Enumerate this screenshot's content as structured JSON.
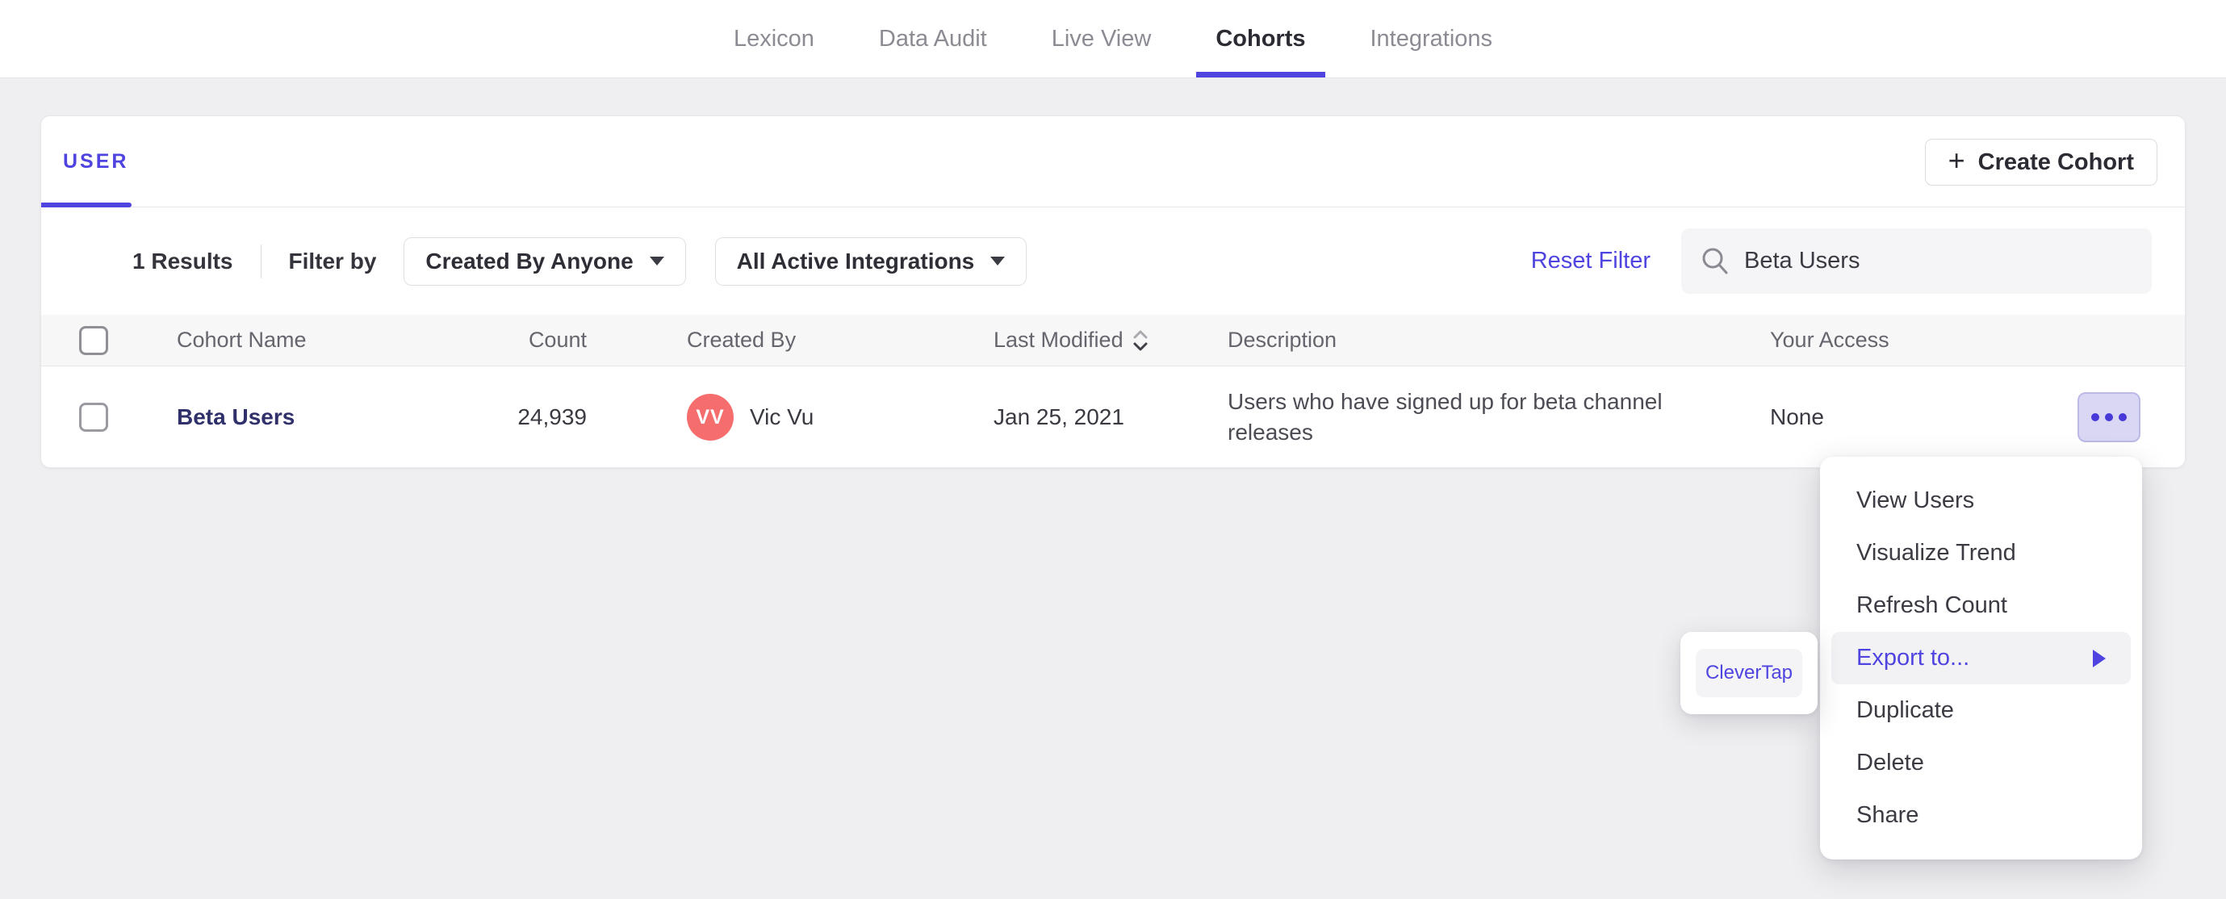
{
  "nav": {
    "tabs": [
      {
        "label": "Lexicon",
        "active": false
      },
      {
        "label": "Data Audit",
        "active": false
      },
      {
        "label": "Live View",
        "active": false
      },
      {
        "label": "Cohorts",
        "active": true
      },
      {
        "label": "Integrations",
        "active": false
      }
    ]
  },
  "panel": {
    "tab_label": "USER",
    "create": {
      "icon": "+",
      "label": "Create Cohort"
    }
  },
  "filters": {
    "results": "1 Results",
    "filter_by_label": "Filter by",
    "created_by": {
      "value": "Created By Anyone"
    },
    "integrations": {
      "value": "All Active Integrations"
    },
    "reset_label": "Reset Filter",
    "search": {
      "value": "Beta Users"
    }
  },
  "table": {
    "columns": [
      "Cohort Name",
      "Count",
      "Created By",
      "Last Modified",
      "Description",
      "Your Access"
    ],
    "rows": [
      {
        "name": "Beta Users",
        "count": "24,939",
        "creator_initials": "VV",
        "creator": "Vic Vu",
        "last_modified": "Jan 25, 2021",
        "description": "Users who have signed up for beta channel releases",
        "access": "None"
      }
    ]
  },
  "menu": {
    "items": [
      {
        "label": "View Users"
      },
      {
        "label": "Visualize Trend"
      },
      {
        "label": "Refresh Count"
      },
      {
        "label": "Export to...",
        "highlighted": true,
        "has_submenu": true
      },
      {
        "label": "Duplicate"
      },
      {
        "label": "Delete"
      },
      {
        "label": "Share"
      }
    ]
  },
  "submenu": {
    "items": [
      {
        "label": "CleverTap"
      }
    ]
  },
  "colors": {
    "accent": "#4f44e0",
    "avatar": "#f66d6e",
    "menu_highlight": "#f2f2f5",
    "actions_button_bg": "#d9d7f3",
    "page_bg": "#efeff1"
  }
}
